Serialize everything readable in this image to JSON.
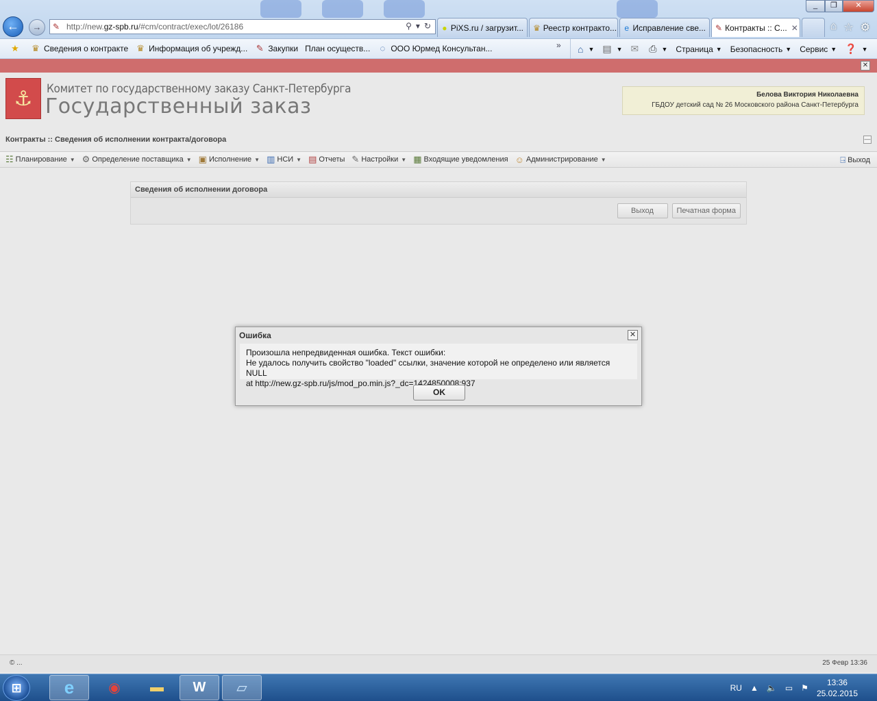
{
  "browser": {
    "url_prefix": "http://new.",
    "url_domain": "gz-spb.ru",
    "url_path": "/#cm/contract/exec/lot/26186",
    "tabs": [
      {
        "label": "PiXS.ru / загрузит...",
        "active": false
      },
      {
        "label": "Реестр контракто...",
        "active": false
      },
      {
        "label": "Исправление све...",
        "active": false
      },
      {
        "label": "Контракты :: С...",
        "active": true
      }
    ],
    "favorites": [
      {
        "label": "Сведения о контракте"
      },
      {
        "label": "Информация об учрежд..."
      },
      {
        "label": "Закупки"
      },
      {
        "label": "План осуществ..."
      },
      {
        "label": "ООО Юрмед Консультан..."
      }
    ],
    "favorites_more": "»",
    "commands": {
      "page": "Страница",
      "security": "Безопасность",
      "service": "Сервис"
    }
  },
  "header": {
    "org_line1": "Комитет по государственному заказу Санкт-Петербурга",
    "org_line2": "Государственный заказ",
    "user_name": "Белова Виктория Николаевна",
    "user_org": "ГБДОУ детский сад № 26 Московского района Санкт-Петербурга"
  },
  "breadcrumb": "Контракты :: Сведения об исполнении контракта/договора",
  "menu": {
    "planning": "Планирование",
    "supplier": "Определение поставщика",
    "execution": "Исполнение",
    "nsi": "НСИ",
    "reports": "Отчеты",
    "settings": "Настройки",
    "notifications": "Входящие уведомления",
    "admin": "Администрирование",
    "exit": "Выход"
  },
  "panel": {
    "title": "Сведения об исполнении договора",
    "exit_button": "Выход",
    "print_button": "Печатная форма"
  },
  "dialog": {
    "title": "Ошибка",
    "line1": "Произошла непредвиденная ошибка. Текст ошибки:",
    "line2": "Не удалось получить свойство \"loaded\" ссылки, значение которой не определено или является NULL",
    "line3": "at http://new.gz-spb.ru/js/mod_po.min.js?_dc=1424850008:937",
    "ok_label": "OK"
  },
  "footer": {
    "copyright": "© ...",
    "datetime": "25 Февр 13:36"
  },
  "taskbar": {
    "lang": "RU",
    "time": "13:36",
    "date": "25.02.2015"
  }
}
